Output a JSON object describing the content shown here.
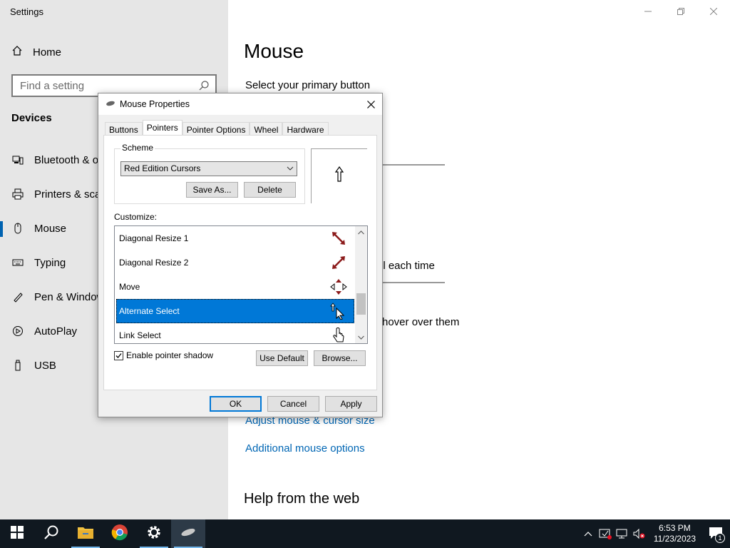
{
  "settings": {
    "window_title": "Settings",
    "home_label": "Home",
    "search_placeholder": "Find a setting",
    "section_title": "Devices",
    "nav_items": [
      {
        "label": "Bluetooth & ot",
        "icon": "bluetooth-devices-icon"
      },
      {
        "label": "Printers & scan",
        "icon": "printer-icon"
      },
      {
        "label": "Mouse",
        "icon": "mouse-icon"
      },
      {
        "label": "Typing",
        "icon": "keyboard-icon"
      },
      {
        "label": "Pen & Window",
        "icon": "pen-icon"
      },
      {
        "label": "AutoPlay",
        "icon": "autoplay-icon"
      },
      {
        "label": "USB",
        "icon": "usb-icon"
      }
    ],
    "main": {
      "title": "Mouse",
      "primary_button_label": "Select your primary button",
      "scroll_text_fragment": "ll each time",
      "hover_text_fragment": "hover over them",
      "link_cursor_size": "Adjust mouse & cursor size",
      "link_additional": "Additional mouse options",
      "help_title": "Help from the web"
    }
  },
  "dialog": {
    "title": "Mouse Properties",
    "tabs": [
      "Buttons",
      "Pointers",
      "Pointer Options",
      "Wheel",
      "Hardware"
    ],
    "active_tab": "Pointers",
    "scheme_label": "Scheme",
    "scheme_value": "Red Edition Cursors",
    "save_as_label": "Save As...",
    "delete_label": "Delete",
    "customize_label": "Customize:",
    "list_items": [
      {
        "label": "Diagonal Resize 1",
        "icon": "diagonal-resize-1-cursor-icon"
      },
      {
        "label": "Diagonal Resize 2",
        "icon": "diagonal-resize-2-cursor-icon"
      },
      {
        "label": "Move",
        "icon": "move-cursor-icon"
      },
      {
        "label": "Alternate Select",
        "icon": "alternate-select-cursor-icon"
      },
      {
        "label": "Link Select",
        "icon": "link-select-cursor-icon"
      }
    ],
    "selected_item": "Alternate Select",
    "shadow_label": "Enable pointer shadow",
    "shadow_checked": true,
    "use_default_label": "Use Default",
    "browse_label": "Browse...",
    "ok_label": "OK",
    "cancel_label": "Cancel",
    "apply_label": "Apply"
  },
  "taskbar": {
    "time": "6:53 PM",
    "date": "11/23/2023",
    "notification_count": "1"
  },
  "colors": {
    "accent": "#0078d7",
    "cursor_red": "#8b1a1a",
    "link": "#0066b4"
  }
}
